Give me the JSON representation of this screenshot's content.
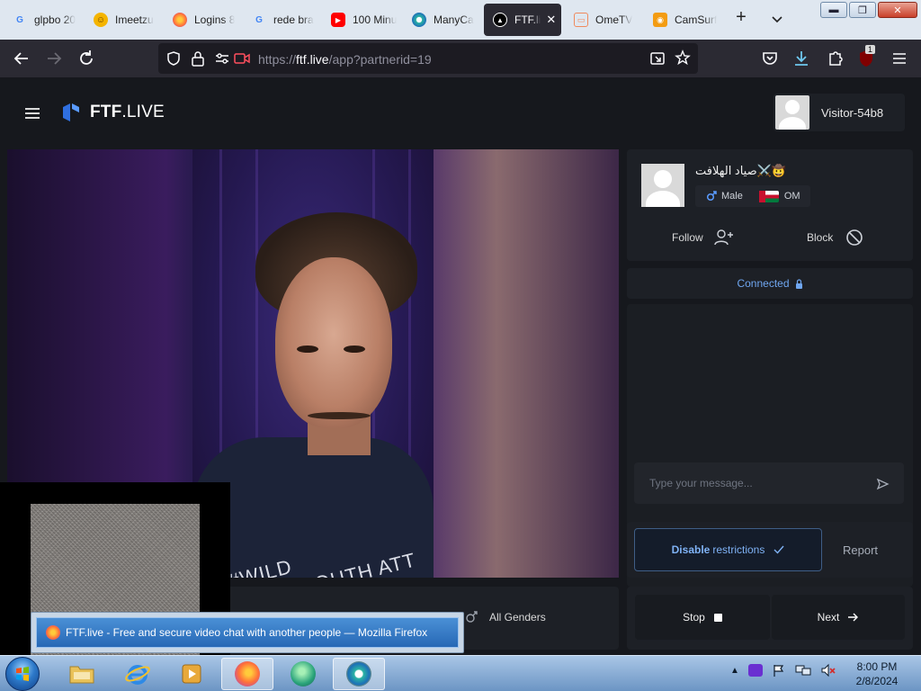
{
  "browser": {
    "tabs": [
      {
        "title": "glpbo 20",
        "icon": "google-icon",
        "color": "#4285f4"
      },
      {
        "title": "Imeetzu",
        "icon": "smiley-icon",
        "color": "#f4b400"
      },
      {
        "title": "Logins 8",
        "icon": "firefox-icon",
        "color": "#ff7139"
      },
      {
        "title": "rede bra",
        "icon": "google-icon",
        "color": "#4285f4"
      },
      {
        "title": "100 Minu",
        "icon": "youtube-icon",
        "color": "#ff0000"
      },
      {
        "title": "ManyCa",
        "icon": "manycam-icon",
        "color": "#2bb5a3"
      },
      {
        "title": "FTF.li",
        "icon": "ftf-icon",
        "color": "#000000",
        "active": true
      },
      {
        "title": "OmeTV",
        "icon": "ometv-icon",
        "color": "#f08a5d"
      },
      {
        "title": "CamSurf",
        "icon": "camsurf-icon",
        "color": "#f39c12"
      }
    ],
    "url": {
      "prefix": "https://",
      "host": "ftf.live",
      "path": "/app?partnerid=19"
    },
    "extension_badge": "1"
  },
  "site": {
    "logo": {
      "bold": "FTF",
      "rest": ".LIVE"
    },
    "visitor_name": "Visitor-54b8"
  },
  "stranger": {
    "name": "صياد الهلافت⚔️🤠",
    "gender": "Male",
    "country": "OM",
    "follow_label": "Follow",
    "block_label": "Block"
  },
  "remote_video": {
    "shirt_text": "#WILD SPIRITYOUTH ATT"
  },
  "status": {
    "label": "Connected"
  },
  "chat": {
    "placeholder": "Type your message..."
  },
  "restrictions": {
    "disable_bold": "Disable",
    "disable_rest": "restrictions",
    "report_label": "Report"
  },
  "filter": {
    "gender_label": "All Genders"
  },
  "actions": {
    "stop_label": "Stop",
    "next_label": "Next"
  },
  "tooltip": {
    "text": "FTF.live - Free and secure video chat with another people — Mozilla Firefox"
  },
  "taskbar": {
    "time": "8:00 PM",
    "date": "2/8/2024"
  }
}
